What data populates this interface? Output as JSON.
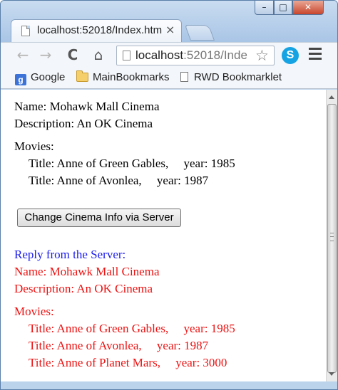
{
  "browser": {
    "tab_title": "localhost:52018/Index.htm",
    "tab_close": "×",
    "url_main": "localhost",
    "url_rest": ":52018/Inde",
    "window_min": "–",
    "window_max": "□",
    "window_close": "✕",
    "skype_label": "S",
    "icons": {
      "back": "back-arrow-icon",
      "forward": "forward-arrow-icon",
      "reload": "reload-icon",
      "home": "home-icon",
      "star": "bookmark-star-icon",
      "menu": "hamburger-menu-icon"
    }
  },
  "bookmarks": [
    {
      "label": "Google",
      "icon": "google-icon"
    },
    {
      "label": "MainBookmarks",
      "icon": "folder-icon"
    },
    {
      "label": "RWD Bookmarklet",
      "icon": "page-icon"
    }
  ],
  "page": {
    "name_line": "Name: Mohawk Mall Cinema",
    "description_line": "Description: An OK Cinema",
    "movies_heading": "Movies:",
    "movies": [
      "Title: Anne of Green Gables,     year: 1985",
      "Title: Anne of Avonlea,     year: 1987"
    ],
    "button_label": "Change Cinema Info via Server",
    "reply_heading": "Reply from the Server:",
    "reply_name_line": "Name: Mohawk Mall Cinema",
    "reply_description_line": "Description: An OK Cinema",
    "reply_movies_heading": "Movies:",
    "reply_movies": [
      "Title: Anne of Green Gables,     year: 1985",
      "Title: Anne of Avonlea,     year: 1987",
      "Title: Anne of Planet Mars,     year: 3000"
    ]
  },
  "colors": {
    "reply_heading": "#1a1aee",
    "reply_text": "#ee1111"
  }
}
